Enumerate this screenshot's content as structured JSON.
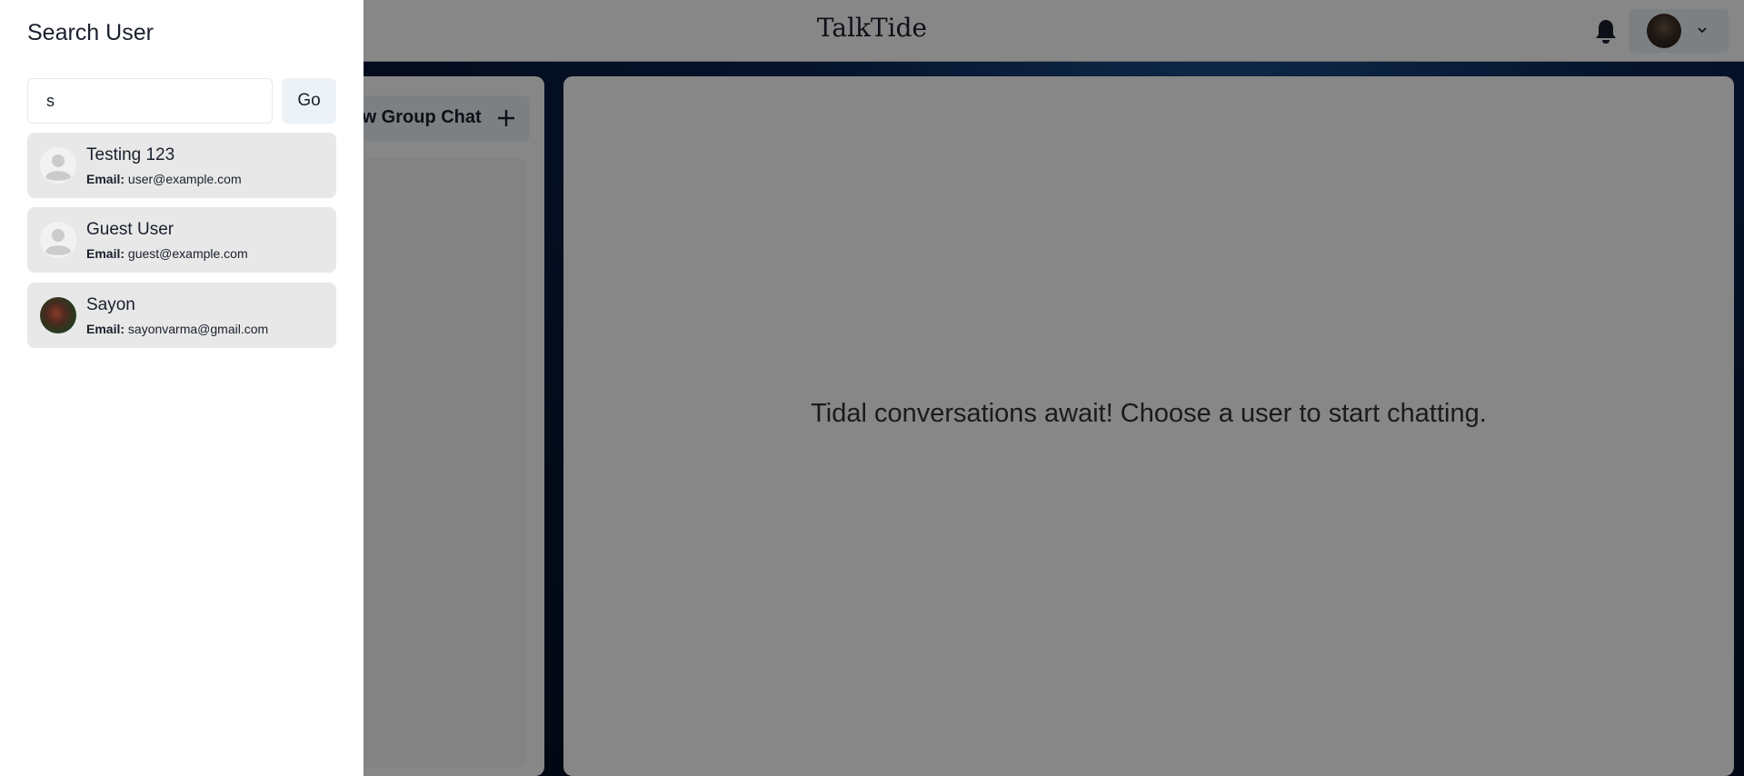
{
  "header": {
    "app_title": "TalkTide",
    "notification_icon": "bell-icon",
    "profile_dropdown_icon": "chevron-down-icon"
  },
  "chats_panel": {
    "new_group_button_label": "New Group Chat",
    "new_group_button_icon": "plus-icon"
  },
  "chat_area": {
    "placeholder": "Tidal conversations await! Choose a user to start chatting."
  },
  "search_drawer": {
    "title": "Search User",
    "search_value": "s",
    "go_button_label": "Go",
    "email_label": "Email:",
    "results": [
      {
        "name": "Testing 123",
        "email": "user@example.com",
        "avatar": "default-avatar"
      },
      {
        "name": "Guest User",
        "email": "guest@example.com",
        "avatar": "default-avatar"
      },
      {
        "name": "Sayon",
        "email": "sayonvarma@gmail.com",
        "avatar": "photo-avatar"
      }
    ]
  },
  "colors": {
    "overlay": "#000000",
    "drawer_bg": "#ffffff",
    "card_bg": "#e8e8e8",
    "button_bg": "#edf2f7",
    "page_bg": "#051530"
  }
}
